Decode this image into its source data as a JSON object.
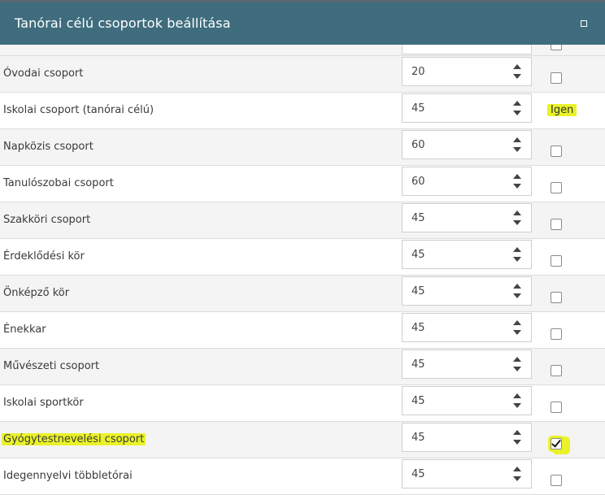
{
  "dialog": {
    "title": "Tanórai célú csoportok beállítása"
  },
  "rows": [
    {
      "label": "Óvodai csoport",
      "value": "20",
      "checked": false
    },
    {
      "label": "Iskolai csoport (tanórai célú)",
      "value": "45",
      "text": "Igen"
    },
    {
      "label": "Napközis csoport",
      "value": "60",
      "checked": false
    },
    {
      "label": "Tanulószobai csoport",
      "value": "60",
      "checked": false
    },
    {
      "label": "Szakköri csoport",
      "value": "45",
      "checked": false
    },
    {
      "label": "Érdeklődési kör",
      "value": "45",
      "checked": false
    },
    {
      "label": "Önképző kör",
      "value": "45",
      "checked": false
    },
    {
      "label": "Énekkar",
      "value": "45",
      "checked": false
    },
    {
      "label": "Művészeti csoport",
      "value": "45",
      "checked": false
    },
    {
      "label": "Iskolai sportkör",
      "value": "45",
      "checked": false
    },
    {
      "label": "Gyógytestnevelési csoport",
      "value": "45",
      "checked": true
    },
    {
      "label": "Idegennyelvi többletórai",
      "value": "45",
      "checked": false
    }
  ],
  "icons": {
    "maximize": "maximize-icon",
    "spin_up": "caret-up-icon",
    "spin_down": "caret-down-icon"
  },
  "colors": {
    "header": "#3f6d7e",
    "highlight": "#eaf228"
  }
}
